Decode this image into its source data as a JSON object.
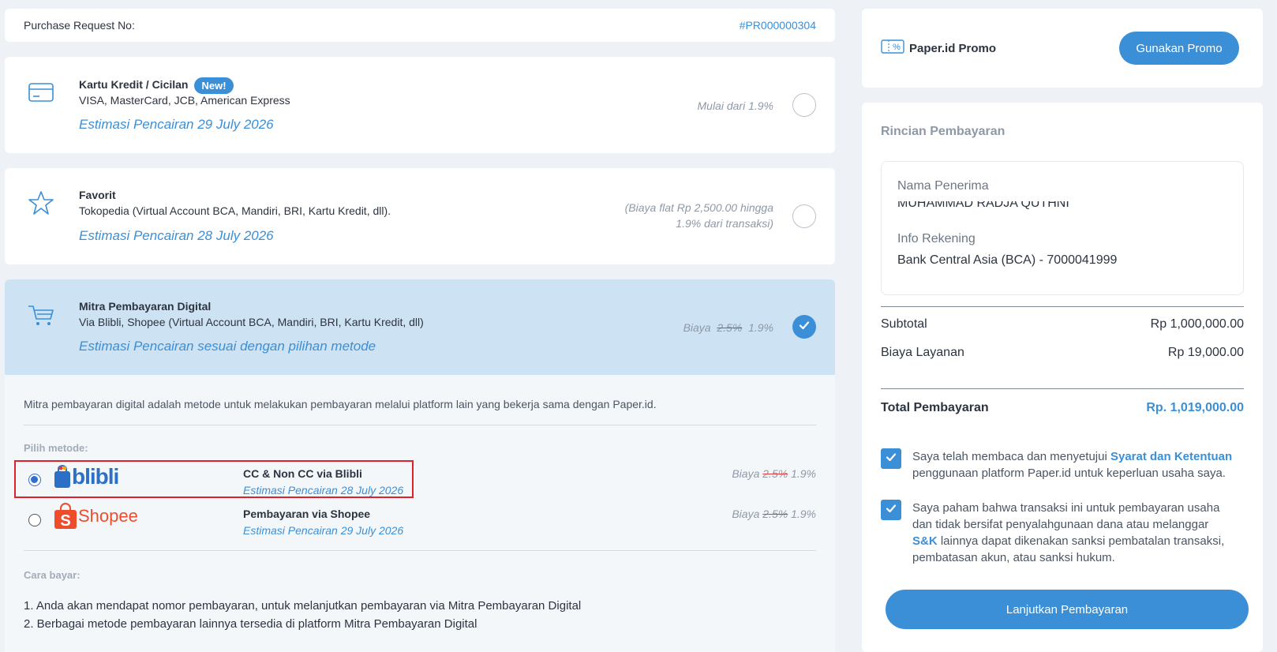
{
  "purchase_request": {
    "label": "Purchase Request No:",
    "number": "#PR000000304"
  },
  "methods": {
    "kartu_kredit": {
      "title": "Kartu Kredit / Cicilan",
      "badge": "New!",
      "subtitle": "VISA, MasterCard, JCB, American Express",
      "estimate": "Estimasi Pencairan  29 July 2026",
      "fee": "Mulai dari 1.9%"
    },
    "favorit": {
      "title": "Favorit",
      "subtitle": "Tokopedia (Virtual Account BCA, Mandiri, BRI, Kartu Kredit, dll).",
      "estimate": "Estimasi Pencairan  28 July 2026",
      "fee_line1": "(Biaya flat Rp 2,500.00 hingga",
      "fee_line2": "1.9% dari transaksi)"
    },
    "mitra": {
      "title": "Mitra Pembayaran Digital",
      "subtitle": "Via Blibli, Shopee (Virtual Account BCA, Mandiri, BRI, Kartu Kredit, dll)",
      "estimate": "Estimasi Pencairan sesuai dengan pilihan metode",
      "fee_label": "Biaya",
      "fee_old": "2.5%",
      "fee_new": "1.9%",
      "description": "Mitra pembayaran digital adalah metode untuk melakukan pembayaran melalui platform lain yang bekerja sama dengan Paper.id.",
      "pilih_label": "Pilih metode:",
      "options": [
        {
          "logo": "blibli",
          "name": "CC & Non CC via Blibli",
          "estimate": "Estimasi Pencairan  28 July 2026",
          "fee_label": "Biaya",
          "fee_old": "2.5%",
          "fee_new": "1.9%"
        },
        {
          "logo": "Shopee",
          "name": "Pembayaran via Shopee",
          "estimate": "Estimasi Pencairan  29 July 2026",
          "fee_label": "Biaya",
          "fee_old": "2.5%",
          "fee_new": "1.9%"
        }
      ],
      "cara_label": "Cara bayar:",
      "steps": [
        "1. Anda akan mendapat nomor pembayaran, untuk melanjutkan pembayaran via Mitra Pembayaran Digital",
        "2. Berbagai metode pembayaran lainnya tersedia di platform Mitra Pembayaran Digital"
      ]
    }
  },
  "promo": {
    "label": "Paper.id Promo",
    "button": "Gunakan Promo"
  },
  "rincian": {
    "title": "Rincian Pembayaran",
    "nama_label": "Nama Penerima",
    "nama_value": "MUHAMMAD RADJA QUTHNI",
    "rekening_label": "Info Rekening",
    "rekening_value": "Bank Central Asia (BCA) - 7000041999",
    "subtotal_label": "Subtotal",
    "subtotal_value": "Rp 1,000,000.00",
    "biaya_label": "Biaya Layanan",
    "biaya_value": "Rp 19,000.00",
    "total_label": "Total Pembayaran",
    "total_value": "Rp. 1,019,000.00",
    "agree1_a": "Saya telah membaca dan menyetujui ",
    "agree1_link": "Syarat dan Ketentuan",
    "agree1_b": "penggunaan platform Paper.id untuk keperluan usaha saya.",
    "agree2_a": "Saya paham bahwa transaksi ini untuk pembayaran usaha dan tidak bersifat penyalahgunaan dana atau melanggar ",
    "agree2_link": "S&K",
    "agree2_b": "lainnya dapat dikenakan sanksi pembatalan transaksi, pembatasan akun, atau sanksi hukum.",
    "continue_button": "Lanjutkan Pembayaran"
  },
  "colors": {
    "accent": "#3b8fd6",
    "selected_bg": "#cde2f2",
    "highlight_border": "#e0202a"
  }
}
